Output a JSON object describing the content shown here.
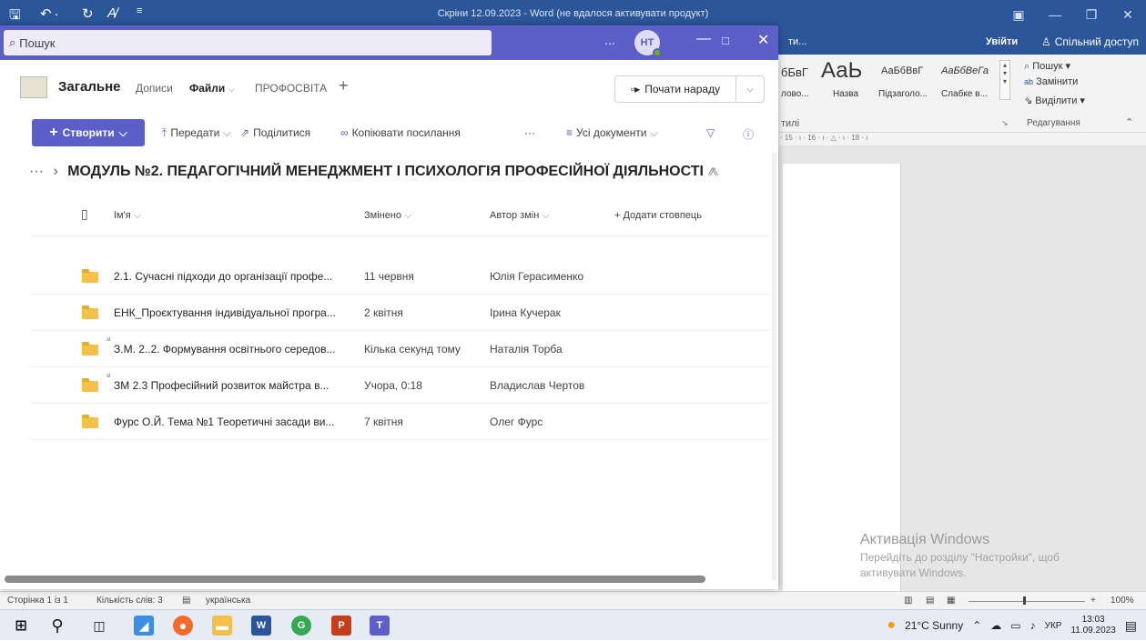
{
  "word": {
    "title": "Скріни 12.09.2023 - Word (не вдалося активувати продукт)",
    "signin": "Увійти",
    "share": "Спільний доступ",
    "tab_partial": "ти...",
    "styles": [
      {
        "sample": "бБвГ",
        "name": "лово..."
      },
      {
        "sample": "АаЬ",
        "name": "Назва"
      },
      {
        "sample": "АаБбВвГ",
        "name": "Підзаголо..."
      },
      {
        "sample": "АаБбВеГа",
        "name": "Слабке в..."
      }
    ],
    "styles_group": "тилі",
    "editing": {
      "find": "Пошук",
      "replace": "Замінити",
      "select": "Виділити",
      "group": "Редагування"
    },
    "ruler": "· 15 · ı · 16 · ı · △ · ı · 18 · ı",
    "activation": {
      "title": "Активація Windows",
      "subtitle": "Перейдіть до розділу \"Настройки\", щоб активувати Windows."
    },
    "status": {
      "page": "Сторінка 1 із 1",
      "words": "Кількість слів: 3",
      "language": "українська",
      "zoom": "100%"
    }
  },
  "taskbar": {
    "weather": "21°C  Sunny",
    "lang": "УКР",
    "time": "13:03",
    "date": "11.09.2023",
    "apps": [
      "start",
      "search",
      "task-view",
      "explorer",
      "firefox",
      "files",
      "word",
      "chrome",
      "powerpoint",
      "teams"
    ]
  },
  "teams": {
    "search_placeholder": "Пошук",
    "more": "...",
    "avatar": "НТ",
    "channel": "Загальне",
    "tabs": [
      "Дописи",
      "Файли",
      "ПРОФОСВІТА"
    ],
    "active_tab": "Файли",
    "meet_button": "Почати нараду",
    "commands": {
      "create": "Створити",
      "upload": "Передати",
      "share": "Поділитися",
      "copy_link": "Копіювати посилання",
      "more": "···",
      "view": "Усі документи"
    },
    "breadcrumb_more": "···",
    "folder_title": "МОДУЛЬ №2. ПЕДАГОГІЧНИЙ МЕНЕДЖМЕНТ І ПСИХОЛОГІЯ ПРОФЕСІЙНОЇ ДІЯЛЬНОСТІ",
    "columns": {
      "name": "Ім'я",
      "modified": "Змінено",
      "author": "Автор змін",
      "add": "+ Додати стовпець"
    },
    "files": [
      {
        "name": "2.1. Сучасні підходи до організації профе...",
        "modified": "11 червня",
        "author": "Юлія Герасименко",
        "new": false
      },
      {
        "name": "ЕНК_Проєктування індивідуальної програ...",
        "modified": "2 квітня",
        "author": "Ірина Кучерак",
        "new": false
      },
      {
        "name": "З.М. 2..2. Формування освітнього середов...",
        "modified": "Кілька секунд тому",
        "author": "Наталія Торба",
        "new": true
      },
      {
        "name": "ЗМ 2.3 Професійний розвиток майстра в...",
        "modified": "Учора, 0:18",
        "author": "Владислав Чертов",
        "new": true
      },
      {
        "name": "Фурс О.Й. Тема №1 Теоретичні засади ви...",
        "modified": "7 квітня",
        "author": "Олег Фурс",
        "new": false
      }
    ]
  }
}
